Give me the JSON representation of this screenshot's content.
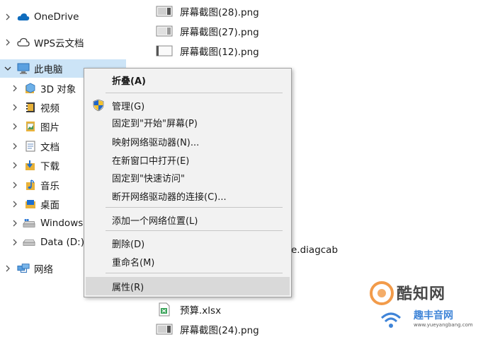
{
  "nav": {
    "items": [
      {
        "label": "OneDrive",
        "expanded": false,
        "icon": "cloud-icon"
      },
      {
        "label": "WPS云文档",
        "expanded": false,
        "icon": "cloud-outline-icon"
      },
      {
        "label": "此电脑",
        "expanded": true,
        "selected": true,
        "icon": "computer-icon"
      },
      {
        "label": "3D 对象",
        "expanded": false,
        "icon": "cube-folder-icon"
      },
      {
        "label": "视频",
        "expanded": false,
        "icon": "video-folder-icon"
      },
      {
        "label": "图片",
        "expanded": false,
        "icon": "pictures-folder-icon"
      },
      {
        "label": "文档",
        "expanded": false,
        "icon": "documents-folder-icon"
      },
      {
        "label": "下载",
        "expanded": false,
        "icon": "downloads-folder-icon"
      },
      {
        "label": "音乐",
        "expanded": false,
        "icon": "music-folder-icon"
      },
      {
        "label": "桌面",
        "expanded": false,
        "icon": "desktop-folder-icon"
      },
      {
        "label": "Windows",
        "expanded": false,
        "icon": "system-drive-icon"
      },
      {
        "label": "Data (D:)",
        "expanded": false,
        "icon": "drive-icon"
      },
      {
        "label": "网络",
        "expanded": false,
        "icon": "network-icon"
      }
    ]
  },
  "files": {
    "items": [
      {
        "name": "屏幕截图(28).png",
        "icon": "image-file-icon"
      },
      {
        "name": "屏幕截图(27).png",
        "icon": "image-file-icon"
      },
      {
        "name": "屏幕截图(12).png",
        "icon": "image-file-icon"
      },
      {
        "name": "e.diagcab",
        "icon": "file-icon"
      },
      {
        "name": "预算.xlsx",
        "icon": "excel-file-icon"
      },
      {
        "name": "屏幕截图(24).png",
        "icon": "image-file-icon"
      }
    ]
  },
  "context_menu": {
    "items": [
      {
        "label": "折叠(A)",
        "bold": true
      },
      {
        "label": "管理(G)",
        "icon": "shield-icon"
      },
      {
        "label": "固定到\"开始\"屏幕(P)"
      },
      {
        "label": "映射网络驱动器(N)..."
      },
      {
        "label": "在新窗口中打开(E)"
      },
      {
        "label": "固定到\"快速访问\""
      },
      {
        "label": "断开网络驱动器的连接(C)..."
      },
      {
        "label": "添加一个网络位置(L)"
      },
      {
        "label": "删除(D)"
      },
      {
        "label": "重命名(M)"
      },
      {
        "label": "属性(R)",
        "hover": true
      }
    ]
  },
  "watermark": {
    "brand": "酷知网",
    "site": "趣丰音网",
    "url": "www.yueyangbang.com"
  },
  "colors": {
    "selected_bg": "#cce4f7",
    "menu_bg": "#f2f2f2",
    "menu_hover": "#d9d9d9",
    "onedrive_blue": "#0f6cbd",
    "folder_yellow": "#e8b23a"
  }
}
